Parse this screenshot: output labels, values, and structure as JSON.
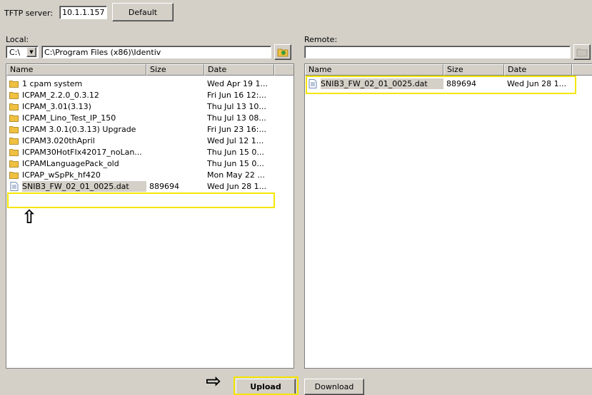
{
  "tftp": {
    "label": "TFTP server:",
    "value": "10.1.1.157",
    "default_label": "Default"
  },
  "local": {
    "label": "Local:",
    "drive": "C:\\",
    "path": "C:\\Program Files (x86)\\Identiv",
    "columns": [
      "Name",
      "Size",
      "Date"
    ],
    "rows": [
      {
        "type": "folder",
        "name": "1 cpam system",
        "size": "",
        "date": "Wed Apr 19 1..."
      },
      {
        "type": "folder",
        "name": "ICPAM_2.2.0_0.3.12",
        "size": "",
        "date": "Fri Jun 16 12:..."
      },
      {
        "type": "folder",
        "name": "ICPAM_3.01(3.13)",
        "size": "",
        "date": "Thu Jul 13 10..."
      },
      {
        "type": "folder",
        "name": "ICPAM_Lino_Test_IP_150",
        "size": "",
        "date": "Thu Jul 13 08..."
      },
      {
        "type": "folder",
        "name": "ICPAM 3.0.1(0.3.13) Upgrade",
        "size": "",
        "date": "Fri Jun 23 16:..."
      },
      {
        "type": "folder",
        "name": "ICPAM3.020thApril",
        "size": "",
        "date": "Wed Jul 12 1..."
      },
      {
        "type": "folder",
        "name": "ICPAM30HotFIx42017_noLan...",
        "size": "",
        "date": "Thu Jun 15 0..."
      },
      {
        "type": "folder",
        "name": "ICPAMLanguagePack_old",
        "size": "",
        "date": "Thu Jun 15 0..."
      },
      {
        "type": "folder",
        "name": "ICPAP_wSpPk_hf420",
        "size": "",
        "date": "Mon May 22 ..."
      },
      {
        "type": "file",
        "name": "SNIB3_FW_02_01_0025.dat",
        "size": "889694",
        "date": "Wed Jun 28 1..."
      }
    ],
    "arrow": "⇧"
  },
  "remote": {
    "label": "Remote:",
    "path": "",
    "columns": [
      "Name",
      "Size",
      "Date"
    ],
    "rows": [
      {
        "type": "file",
        "name": "SNIB3_FW_02_01_0025.dat",
        "size": "889694",
        "date": "Wed Jun 28 1..."
      }
    ]
  },
  "actions": {
    "arrow": "⇨",
    "upload_label": "Upload",
    "download_label": "Download"
  },
  "colors": {
    "highlight": "#f5e600",
    "window": "#d4d0c8",
    "folder": "#f0c040"
  }
}
